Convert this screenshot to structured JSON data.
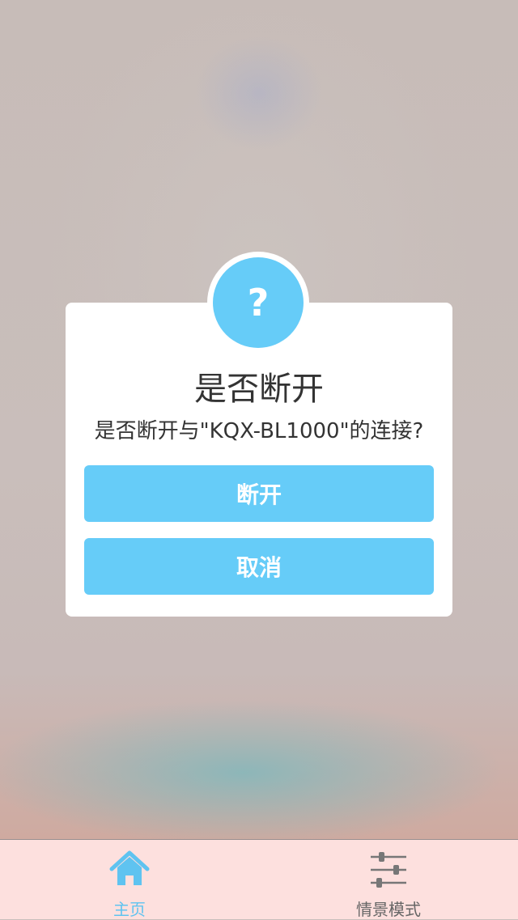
{
  "dialog": {
    "icon": "question-icon",
    "icon_glyph": "?",
    "title": "是否断开",
    "message": "是否断开与\"KQX-BL1000\"的连接?",
    "confirm_label": "断开",
    "cancel_label": "取消",
    "accent_color": "#66ccf8"
  },
  "tabbar": {
    "tabs": [
      {
        "label": "主页",
        "icon": "home-icon",
        "active": true
      },
      {
        "label": "情景模式",
        "icon": "sliders-icon",
        "active": false
      }
    ],
    "active_color": "#5fc3f0"
  }
}
